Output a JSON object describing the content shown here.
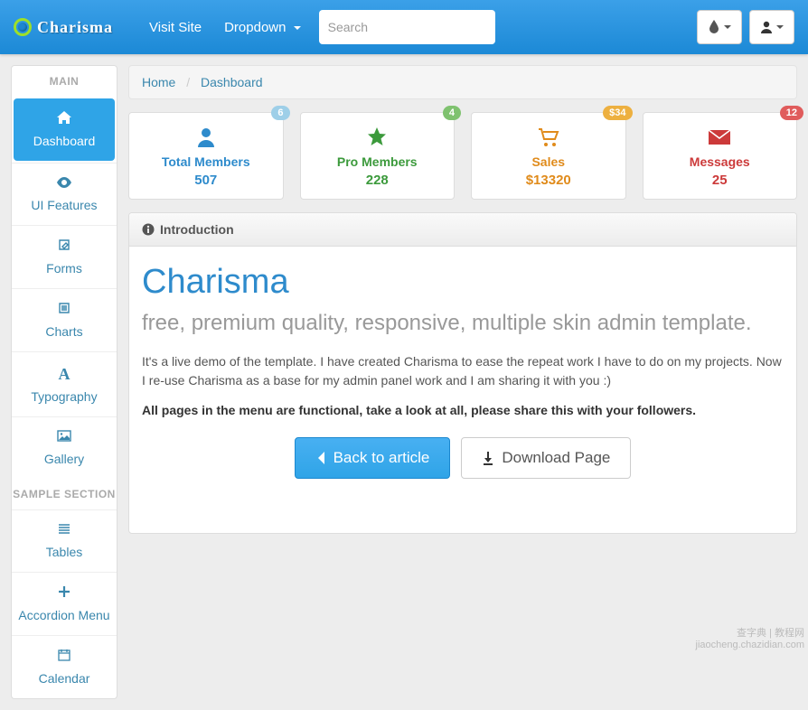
{
  "logo_text": "Charisma",
  "nav": {
    "visit_site": "Visit Site",
    "dropdown": "Dropdown"
  },
  "search": {
    "placeholder": "Search"
  },
  "breadcrumb": {
    "home": "Home",
    "current": "Dashboard"
  },
  "sidebar": {
    "header_main": "MAIN",
    "header_sample": "SAMPLE SECTION",
    "items": {
      "dashboard": "Dashboard",
      "ui": "UI Features",
      "forms": "Forms",
      "charts": "Charts",
      "typography": "Typography",
      "gallery": "Gallery",
      "tables": "Tables",
      "accordion": "Accordion Menu",
      "calendar": "Calendar"
    }
  },
  "stats": {
    "members": {
      "badge": "6",
      "title": "Total Members",
      "value": "507"
    },
    "pro": {
      "badge": "4",
      "title": "Pro Members",
      "value": "228"
    },
    "sales": {
      "badge": "$34",
      "title": "Sales",
      "value": "$13320"
    },
    "messages": {
      "badge": "12",
      "title": "Messages",
      "value": "25"
    }
  },
  "intro": {
    "header": "Introduction",
    "title": "Charisma",
    "subtitle": "free, premium quality, responsive, multiple skin admin template.",
    "text": "It's a live demo of the template. I have created Charisma to ease the repeat work I have to do on my projects. Now I re-use Charisma as a base for my admin panel work and I am sharing it with you :)",
    "bold": "All pages in the menu are functional, take a look at all, please share this with your followers.",
    "back_btn": "Back to article",
    "download_btn": "Download Page"
  },
  "watermark": {
    "line1": "查字典 | 教程网",
    "line2": "jiaocheng.chazidian.com"
  }
}
